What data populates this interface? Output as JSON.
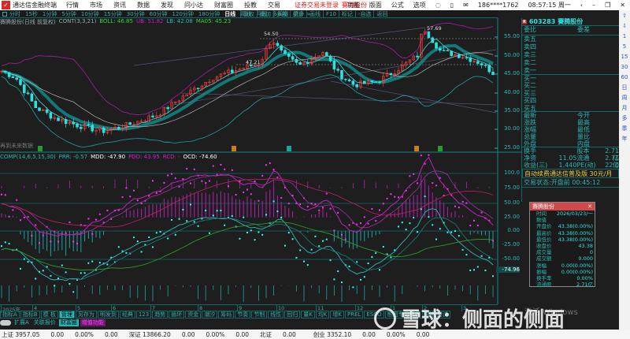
{
  "app": {
    "title": "通达信金融终端",
    "menu": [
      "行情",
      "市场",
      "资讯",
      "数据",
      "发现",
      "问小达",
      "财富圈",
      "投教",
      "交易"
    ],
    "notice": "证券交易未登录",
    "stock_name": "賽腾股份",
    "right_menu": [
      "功能",
      "版面",
      "公式",
      "选项"
    ],
    "user": "186****1762",
    "time": "08:57:15 周一"
  },
  "periods": [
    "分时",
    "15秒",
    "1分钟",
    "5分钟",
    "10分钟",
    "15分钟",
    "30分钟",
    "60分钟",
    "120分钟",
    "180分钟",
    "日线",
    "周线",
    "月线",
    "多周期",
    "更多 >"
  ],
  "selected_period": "日线",
  "tool_buttons": [
    "复权",
    "叠加",
    "多股",
    "统计",
    "画线",
    "F10",
    "标记",
    "-自选",
    "返回"
  ],
  "info": {
    "name": "賽腾股份(日线 前复权)",
    "indicator": "CONT(3,3,21)",
    "boll": "BOLL: 46.85",
    "ub": "UB: 51.82",
    "lb": "LB: 42.08",
    "ma": "MA05: 45.23"
  },
  "chart_marks": {
    "high1": "54.50",
    "high2": "57.69",
    "low1": "47.21",
    "no_future": "再到未来数据"
  },
  "price_axis": [
    "55.00",
    "50.00",
    "45.00",
    "40.00",
    "35.00",
    "30.00",
    "25.00"
  ],
  "price_path": [
    [
      0,
      46
    ],
    [
      20,
      44
    ],
    [
      45,
      36
    ],
    [
      70,
      33
    ],
    [
      100,
      31
    ],
    [
      130,
      29.5
    ],
    [
      160,
      31
    ],
    [
      200,
      34
    ],
    [
      240,
      40
    ],
    [
      270,
      44
    ],
    [
      300,
      46
    ],
    [
      330,
      48
    ],
    [
      345,
      54.5
    ],
    [
      360,
      50
    ],
    [
      380,
      47.21
    ],
    [
      410,
      51
    ],
    [
      430,
      45
    ],
    [
      450,
      42
    ],
    [
      480,
      43
    ],
    [
      510,
      47
    ],
    [
      530,
      50
    ],
    [
      537,
      57.69
    ],
    [
      560,
      51
    ],
    [
      585,
      50
    ],
    [
      610,
      48
    ],
    [
      628,
      45
    ]
  ],
  "indicator_panel": {
    "name": "COMP(14,6,5,15,30)",
    "prr": "PRR: -0.57",
    "mdd": "MDD: -47.90",
    "pdd": "PDD: 43.95",
    "rcd": "RCD: -",
    "ocd": "OCD: -74.60",
    "axis": [
      "100.0",
      "75.00",
      "50.00",
      "25.00",
      "0.00",
      "-25.00",
      "-50.00",
      "-74.96"
    ]
  },
  "colors": {
    "up": "#ff3c3c",
    "down": "#2fe0e0",
    "magenta": "#d020d0",
    "teal": "#1aa3a3",
    "green": "#2a9a2a",
    "yellow": "#e8d040"
  },
  "quote": {
    "code": "603283",
    "name": "賽腾股份",
    "ratio": [
      "委比",
      "委差"
    ],
    "sell": [
      "卖五",
      "卖四",
      "卖三",
      "卖二",
      "卖一"
    ],
    "buy": [
      "买一",
      "买二",
      "买三",
      "买四",
      "买五"
    ],
    "stats": [
      [
        "最新",
        "",
        "今开"
      ],
      [
        "涨跌",
        "",
        "最高"
      ],
      [
        "涨幅",
        "",
        "最低"
      ],
      [
        "总量",
        "",
        "量比"
      ],
      [
        "外盘",
        "",
        "内盘"
      ]
    ],
    "fund": [
      [
        "换手",
        "",
        "股本",
        "2.71亿"
      ],
      [
        "净资",
        "11.05",
        "流通",
        "2.71亿"
      ],
      [
        "收益(三)",
        "1.440",
        "PE(动)",
        "22.0"
      ]
    ],
    "banner": "自动续费通达信普及版  30元/月",
    "trade_state": "交易状态:开盘前  00:45:12"
  },
  "popup": {
    "title": "賽腾股份",
    "rows": [
      [
        "时间",
        "2026/03/23/一"
      ],
      [
        "数值",
        ""
      ],
      [
        "开盘价",
        "43.38(0.00%)"
      ],
      [
        "最高价",
        "43.38(0.00%)"
      ],
      [
        "最低价",
        "43.38(0.00%)"
      ],
      [
        "收盘价",
        "43.38"
      ],
      [
        "成交量",
        "0"
      ],
      [
        "成交额",
        "0.000"
      ],
      [
        "涨幅",
        "0.00(0.00%)"
      ],
      [
        "振幅",
        "0.00(0.00%)"
      ],
      [
        "换手率",
        "0.00%"
      ],
      [
        "流通股",
        "2.71亿"
      ]
    ]
  },
  "xaxis": [
    "2025年",
    "4",
    "5",
    "6",
    "7",
    "8",
    "9",
    "10",
    "11",
    "12",
    "1",
    "2",
    "3"
  ],
  "tabs": [
    "指标A",
    "指标B",
    "模 板",
    "管理",
    "另存为",
    "明发到",
    "经典",
    "123",
    "趋势",
    "循环",
    "资金",
    "潮汐",
    "筹码",
    "节奏",
    "节制",
    "线性",
    "回归",
    "量K",
    "均K",
    "增K",
    "PREL",
    "ESCO",
    "制图专用模板",
    "指标测试"
  ],
  "selected_tab": "管理",
  "tabs2": [
    "扩展A",
    "关联报价",
    "财富圈",
    "增值功能"
  ],
  "status": {
    "sh": "上证 3957.05",
    "sh_vals": [
      "0.00",
      "0.00%",
      "0.00"
    ],
    "sz": "深证 13866.20",
    "sz_vals": [
      "0.00",
      "0.00%",
      "0.00"
    ],
    "bz": "北证",
    "bz_val": "0.00",
    "cy": "创业 3352.10",
    "cy_vals": [
      "0.00",
      "0.00%",
      "0.00"
    ]
  },
  "right_toolbar": [
    "⇧",
    "⇩",
    "1",
    "5",
    "15",
    "30",
    "60",
    "日",
    "周",
    "月",
    "多",
    "季",
    "年"
  ],
  "watermark": "雪球：侧面的侧面",
  "activate": "激活 Windows"
}
